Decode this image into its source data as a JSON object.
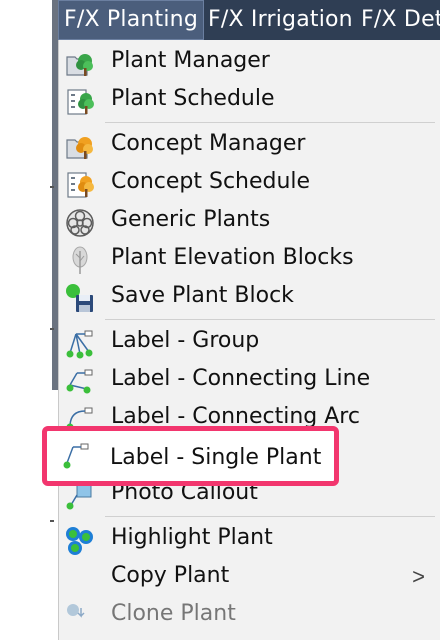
{
  "menubar": {
    "tabs": [
      {
        "label": "F/X Planting"
      },
      {
        "label": "F/X Irrigation"
      },
      {
        "label": "F/X Det"
      }
    ]
  },
  "menu": {
    "items": [
      {
        "label": "Plant Manager",
        "icon": "folder-tree-icon"
      },
      {
        "label": "Plant Schedule",
        "icon": "schedule-tree-icon"
      },
      {
        "label": "Concept Manager",
        "icon": "folder-concept-tree-icon"
      },
      {
        "label": "Concept Schedule",
        "icon": "schedule-concept-tree-icon"
      },
      {
        "label": "Generic Plants",
        "icon": "generic-plant-icon"
      },
      {
        "label": "Plant Elevation Blocks",
        "icon": "elevation-tree-icon"
      },
      {
        "label": "Save Plant Block",
        "icon": "save-block-icon"
      },
      {
        "label": "Label - Group",
        "icon": "label-group-icon"
      },
      {
        "label": "Label - Connecting Line",
        "icon": "label-line-icon"
      },
      {
        "label": "Label - Connecting Arc",
        "icon": "label-arc-icon"
      },
      {
        "label": "Label - Single Plant",
        "icon": "label-single-icon"
      },
      {
        "label": "Photo Callout",
        "icon": "photo-callout-icon"
      },
      {
        "label": "Highlight Plant",
        "icon": "highlight-plant-icon"
      },
      {
        "label": "Copy Plant",
        "icon": "none",
        "submenu": ">"
      },
      {
        "label": "Clone Plant",
        "icon": "clone-plant-icon"
      }
    ]
  },
  "colors": {
    "menubar_bg": "#2f3e54",
    "active_tab_bg": "#4b5e7c",
    "menu_bg": "#f2f2f2",
    "highlight_border": "#f2366e",
    "tree_green": "#3aa64a",
    "tree_orange": "#f0a020"
  }
}
